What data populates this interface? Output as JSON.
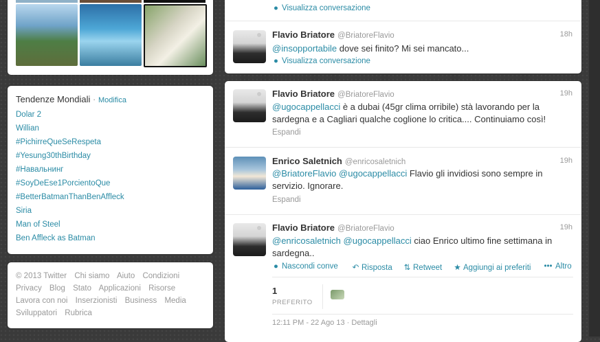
{
  "photos": {
    "items": [
      "photo-coast",
      "photo-boats",
      "photo-dinner"
    ]
  },
  "trends": {
    "title": "Tendenze Mondiali",
    "separator": "·",
    "edit_label": "Modifica",
    "items": [
      "Dolar 2",
      "Willian",
      "#PichirreQueSeRespeta",
      "#Yesung30thBirthday",
      "#Навальнинг",
      "#SoyDeEse1PorcientoQue",
      "#BetterBatmanThanBenAffleck",
      "Siria",
      "Man of Steel",
      "Ben Affleck as Batman"
    ]
  },
  "footer": {
    "row1": [
      "© 2013 Twitter",
      "Chi siamo",
      "Aiuto",
      "Condizioni"
    ],
    "row2": [
      "Privacy",
      "Blog",
      "Stato",
      "Applicazioni",
      "Risorse"
    ],
    "row3": [
      "Lavora con noi",
      "Inserzionisti",
      "Business",
      "Media"
    ],
    "row4": [
      "Sviluppatori",
      "Rubrica"
    ]
  },
  "stream": {
    "top_card": {
      "view_conversation": "Visualizza conversazione",
      "tweet": {
        "name": "Flavio Briatore",
        "handle": "@BriatoreFlavio",
        "time": "18h",
        "mention": "@insopportabile",
        "text": " dove sei finito? Mi sei mancato...",
        "view_conversation": "Visualizza conversazione"
      }
    },
    "conversation": [
      {
        "name": "Flavio Briatore",
        "handle": "@BriatoreFlavio",
        "time": "19h",
        "mention": "@ugocappellacci",
        "text": " è a dubai (45gr clima orribile) stà lavorando per la sardegna e a Cagliari qualche coglione lo critica.... Continuiamo così!",
        "expand": "Espandi"
      },
      {
        "name": "Enrico Saletnich",
        "handle": "@enricosaletnich",
        "time": "19h",
        "mention1": "@BriatoreFlavio",
        "mention2": "@ugocappellacci",
        "text": " Flavio gli invidiosi sono sempre in servizio. Ignorare.",
        "expand": "Espandi"
      },
      {
        "name": "Flavio Briatore",
        "handle": "@BriatoreFlavio",
        "time": "19h",
        "mention1": "@enricosaletnich",
        "mention2": "@ugocappellacci",
        "text": " ciao Enrico ultimo fine settimana in sardegna..",
        "actions": {
          "hide": "Nascondi conve",
          "reply": "Risposta",
          "retweet": "Retweet",
          "favorite": "Aggiungi ai preferiti",
          "more": "Altro"
        },
        "favorites_count": "1",
        "favorites_label": "PREFERITO",
        "timestamp": "12:11 PM - 22 Ago 13",
        "details": "Dettagli"
      }
    ]
  },
  "colors": {
    "link": "#2a8ba5",
    "muted": "#999999",
    "background": "#3a3a3a"
  }
}
